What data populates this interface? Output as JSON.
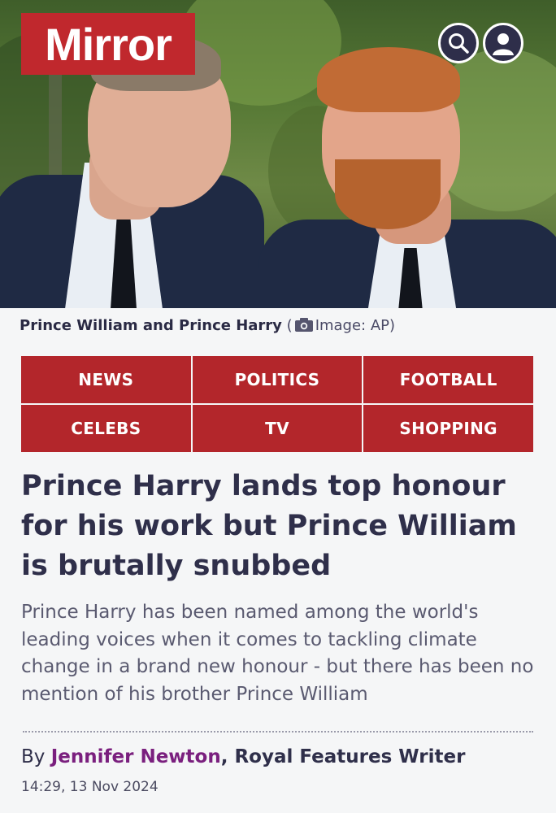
{
  "header": {
    "logo_text": "Mirror",
    "brand_color": "#c0282d",
    "search_icon": "search-icon",
    "account_icon": "user-icon"
  },
  "image": {
    "caption": "Prince William and Prince Harry",
    "credit_prefix": "(",
    "credit": "Image: AP)",
    "camera_icon": "camera-icon"
  },
  "nav": {
    "items": [
      {
        "label": "NEWS"
      },
      {
        "label": "POLITICS"
      },
      {
        "label": "FOOTBALL"
      },
      {
        "label": "CELEBS"
      },
      {
        "label": "TV"
      },
      {
        "label": "SHOPPING"
      }
    ],
    "color": "#b3262b"
  },
  "article": {
    "headline": "Prince Harry lands top honour for his work but Prince William is brutally snubbed",
    "standfirst": "Prince Harry has been named among the world's leading voices when it comes to tackling climate change in a brand new honour - but there has been no mention of his brother Prince William",
    "byline_prefix": "By ",
    "author": "Jennifer Newton",
    "author_role": ", Royal Features Writer",
    "timestamp": "14:29, 13 Nov 2024",
    "author_color": "#7a1f7e"
  }
}
